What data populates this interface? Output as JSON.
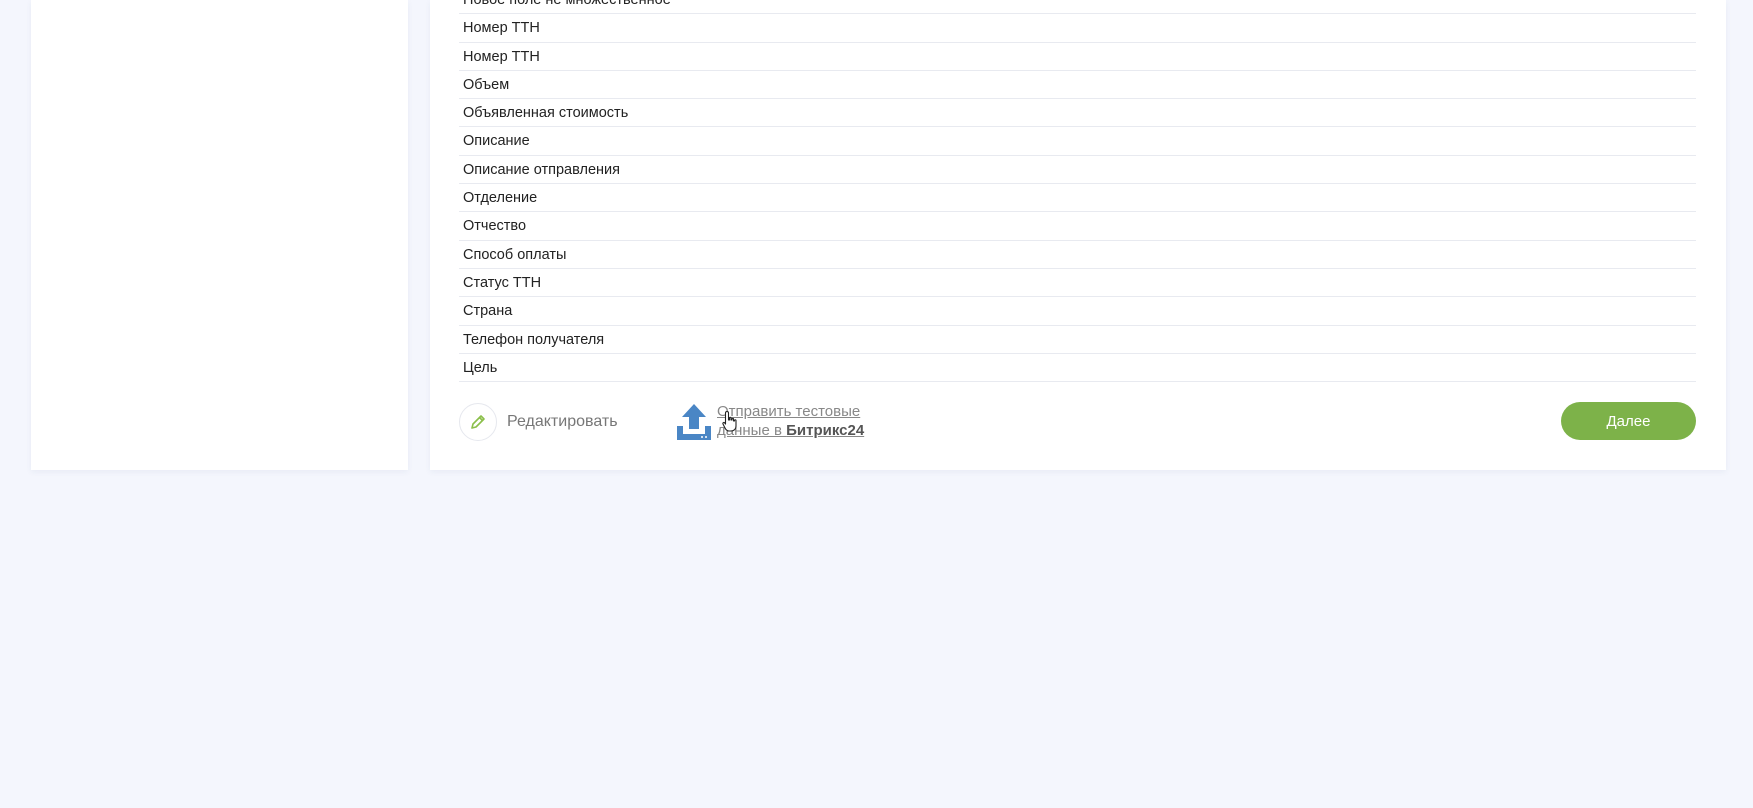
{
  "fields": [
    "Новое поле не множественное",
    "Номер ТТН",
    "Номер ТТН",
    "Объем",
    "Объявленная стоимость",
    "Описание",
    "Описание отправления",
    "Отделение",
    "Отчество",
    "Способ оплаты",
    "Статус ТТН",
    "Страна",
    "Телефон получателя",
    "Цель"
  ],
  "footer": {
    "edit_label": "Редактировать",
    "send_test_line1": "Отправить тестовые",
    "send_test_line2_prefix": "данные в ",
    "send_test_brand": "Битрикс24",
    "next_label": "Далее"
  },
  "icons": {
    "edit": "pencil-icon",
    "send": "upload-icon",
    "cursor": "hand-cursor-icon"
  },
  "colors": {
    "accent_green": "#7db249",
    "upload_blue": "#4a86c5",
    "pencil_green": "#8bbf4a",
    "background": "#f4f6fd"
  }
}
